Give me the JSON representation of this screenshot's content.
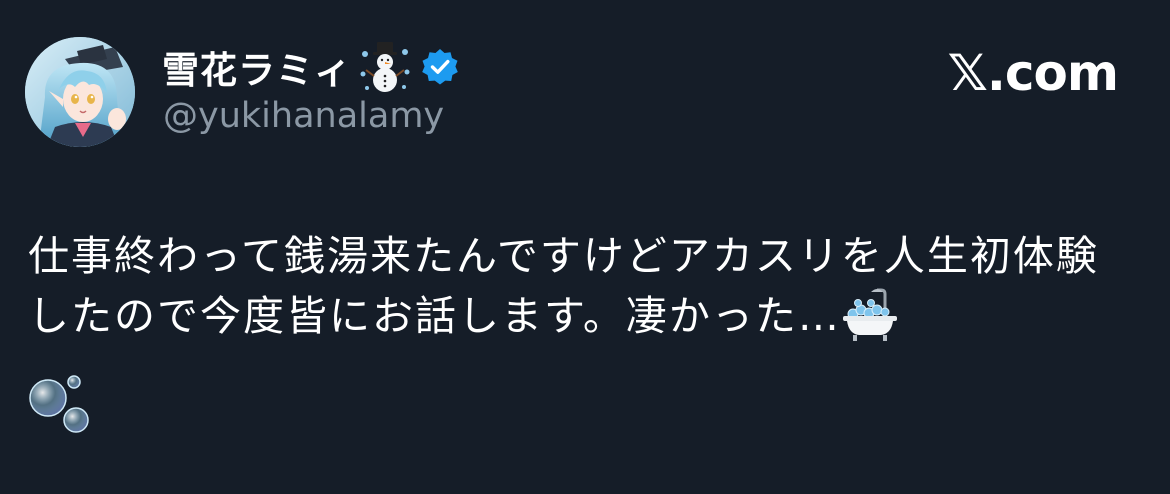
{
  "author": {
    "display_name": "雪花ラミィ",
    "handle": "@yukihanalamy",
    "verified": true,
    "name_emoji": "snowman-with-snow-icon",
    "avatar": "anime-character-avatar"
  },
  "branding": {
    "site_label": "𝕏.com"
  },
  "tweet": {
    "text": "仕事終わって銭湯来たんですけどアカスリを人生初体験したので今度皆にお話します。凄かった…",
    "trailing_emojis": [
      "bathtub-icon",
      "bubbles-icon"
    ]
  },
  "colors": {
    "background": "#151d28",
    "text_primary": "#ffffff",
    "text_secondary": "#8b98a5",
    "verified_badge": "#1d9bf0"
  }
}
